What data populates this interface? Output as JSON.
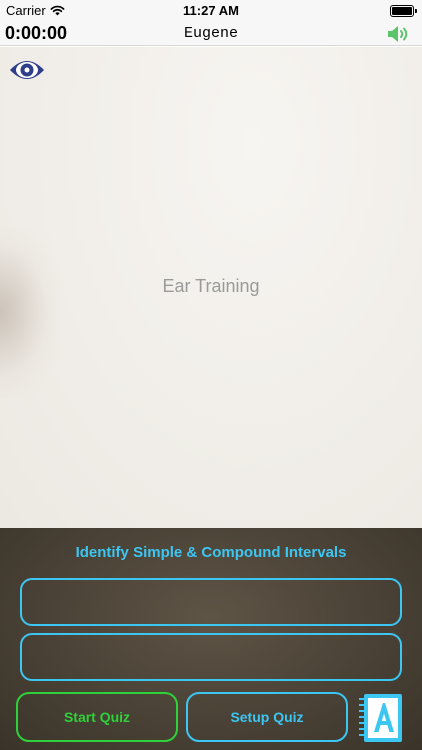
{
  "status_bar": {
    "carrier": "Carrier",
    "time": "11:27 AM"
  },
  "nav": {
    "timer": "0:00:00",
    "title": "Eugene",
    "sound_icon": "speaker-icon"
  },
  "content": {
    "label": "Ear Training",
    "eye_icon": "eye-icon"
  },
  "quiz_panel": {
    "title": "Identify Simple & Compound Intervals",
    "answers": [
      "",
      ""
    ],
    "start_button": "Start Quiz",
    "setup_button": "Setup Quiz",
    "notebook_icon": "notebook-icon",
    "colors": {
      "accent": "#3cc6f2",
      "start": "#2fd13a",
      "panel_bg": "#4a4236"
    }
  }
}
